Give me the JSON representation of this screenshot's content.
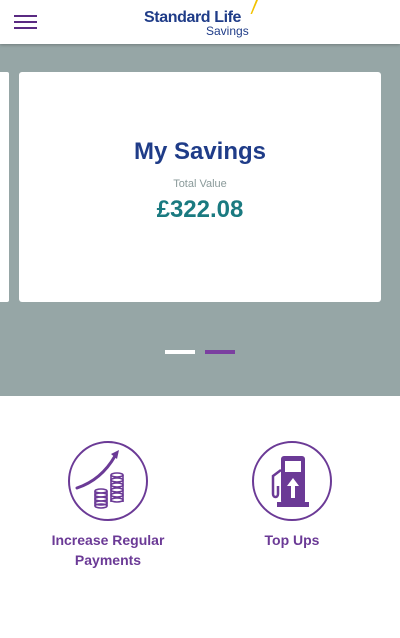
{
  "header": {
    "logo_main": "Standard Life",
    "logo_sub": "Savings"
  },
  "card": {
    "title": "My Savings",
    "label": "Total Value",
    "value": "£322.08"
  },
  "carousel": {
    "active_index": 2,
    "total": 2
  },
  "actions": [
    {
      "label": "Increase Regular Payments",
      "icon": "coins-growth-icon"
    },
    {
      "label": "Top Ups",
      "icon": "fuel-pump-icon"
    }
  ],
  "colors": {
    "brand_blue": "#1f3c88",
    "purple": "#6b3a96",
    "teal": "#1a7a80",
    "carousel_bg": "#96a6a6"
  }
}
